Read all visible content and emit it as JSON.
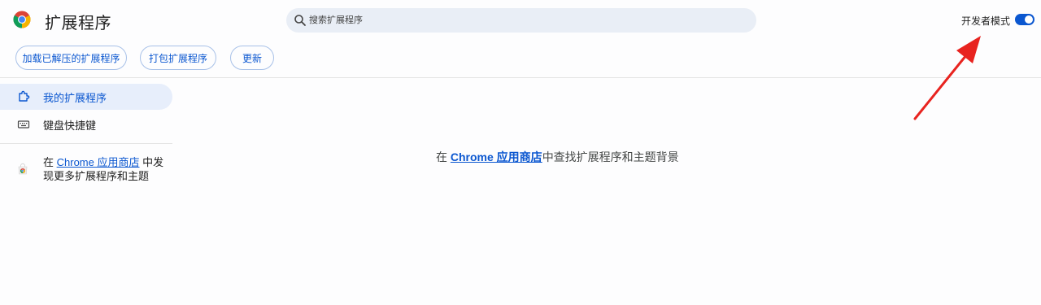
{
  "header": {
    "title": "扩展程序",
    "search_placeholder": "搜索扩展程序",
    "dev_mode_label": "开发者模式",
    "dev_mode_enabled": true
  },
  "toolbar": {
    "load_unpacked": "加载已解压的扩展程序",
    "pack_extension": "打包扩展程序",
    "update": "更新"
  },
  "sidebar": {
    "items": [
      {
        "label": "我的扩展程序",
        "icon": "puzzle-icon",
        "active": true
      },
      {
        "label": "键盘快捷键",
        "icon": "keyboard-icon",
        "active": false
      }
    ],
    "promo": {
      "prefix": "在 ",
      "link": "Chrome 应用商店",
      "suffix": " 中发现更多扩展程序和主题"
    }
  },
  "main": {
    "empty_prefix": "在 ",
    "empty_link": "Chrome 应用商店",
    "empty_suffix": "中查找扩展程序和主题背景"
  },
  "colors": {
    "accent": "#0b57d0",
    "annotation_arrow": "#e8231f",
    "search_bg": "#e9eef6"
  }
}
